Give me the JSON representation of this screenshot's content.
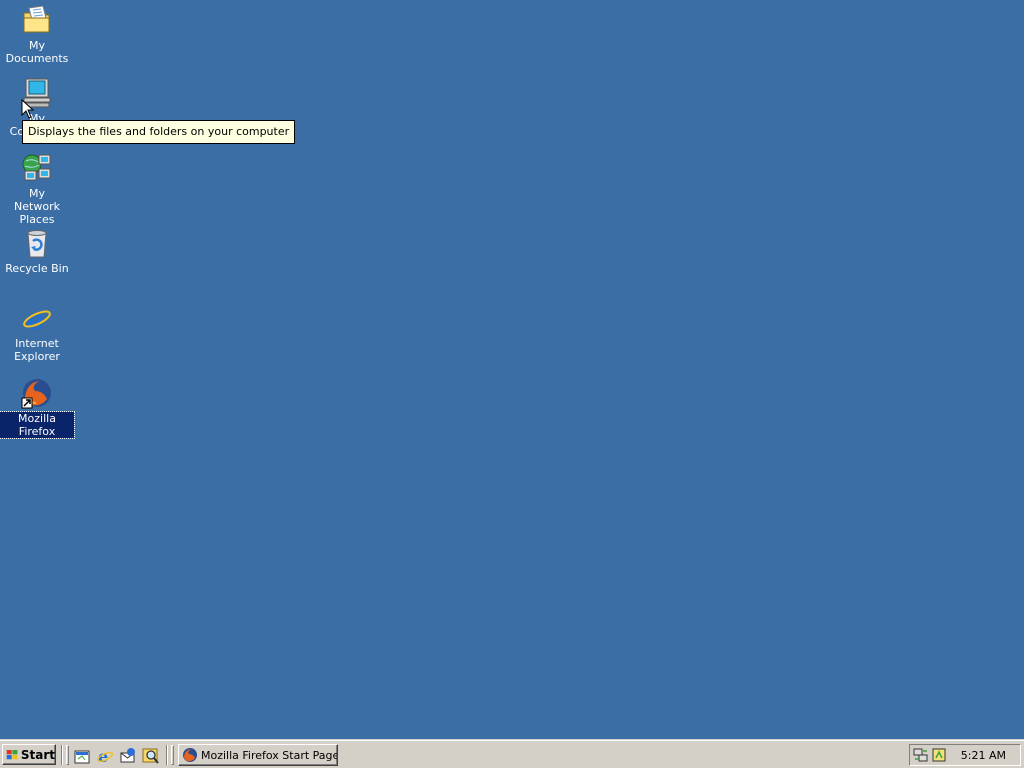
{
  "desktop": {
    "background_color": "#3a6ea5",
    "icons": [
      {
        "label": "My Documents",
        "icon": "folder-documents-icon"
      },
      {
        "label": "My Computer",
        "icon": "computer-icon"
      },
      {
        "label": "My Network Places",
        "icon": "network-places-icon"
      },
      {
        "label": "Recycle Bin",
        "icon": "recycle-bin-icon"
      },
      {
        "label": "Internet Explorer",
        "icon": "internet-explorer-icon"
      },
      {
        "label": "Mozilla Firefox",
        "icon": "firefox-shortcut-icon",
        "selected": true
      }
    ]
  },
  "tooltip": {
    "text": "Displays the files and folders on your computer"
  },
  "taskbar": {
    "start_label": "Start",
    "quick_launch": [
      "show-desktop-icon",
      "internet-explorer-icon",
      "outlook-express-icon",
      "search-icon"
    ],
    "tasks": [
      {
        "label": "Mozilla Firefox Start Page...",
        "icon": "firefox-icon"
      }
    ],
    "tray_icons": [
      "network-icon",
      "tray-app-icon"
    ],
    "clock": "5:21 AM"
  }
}
